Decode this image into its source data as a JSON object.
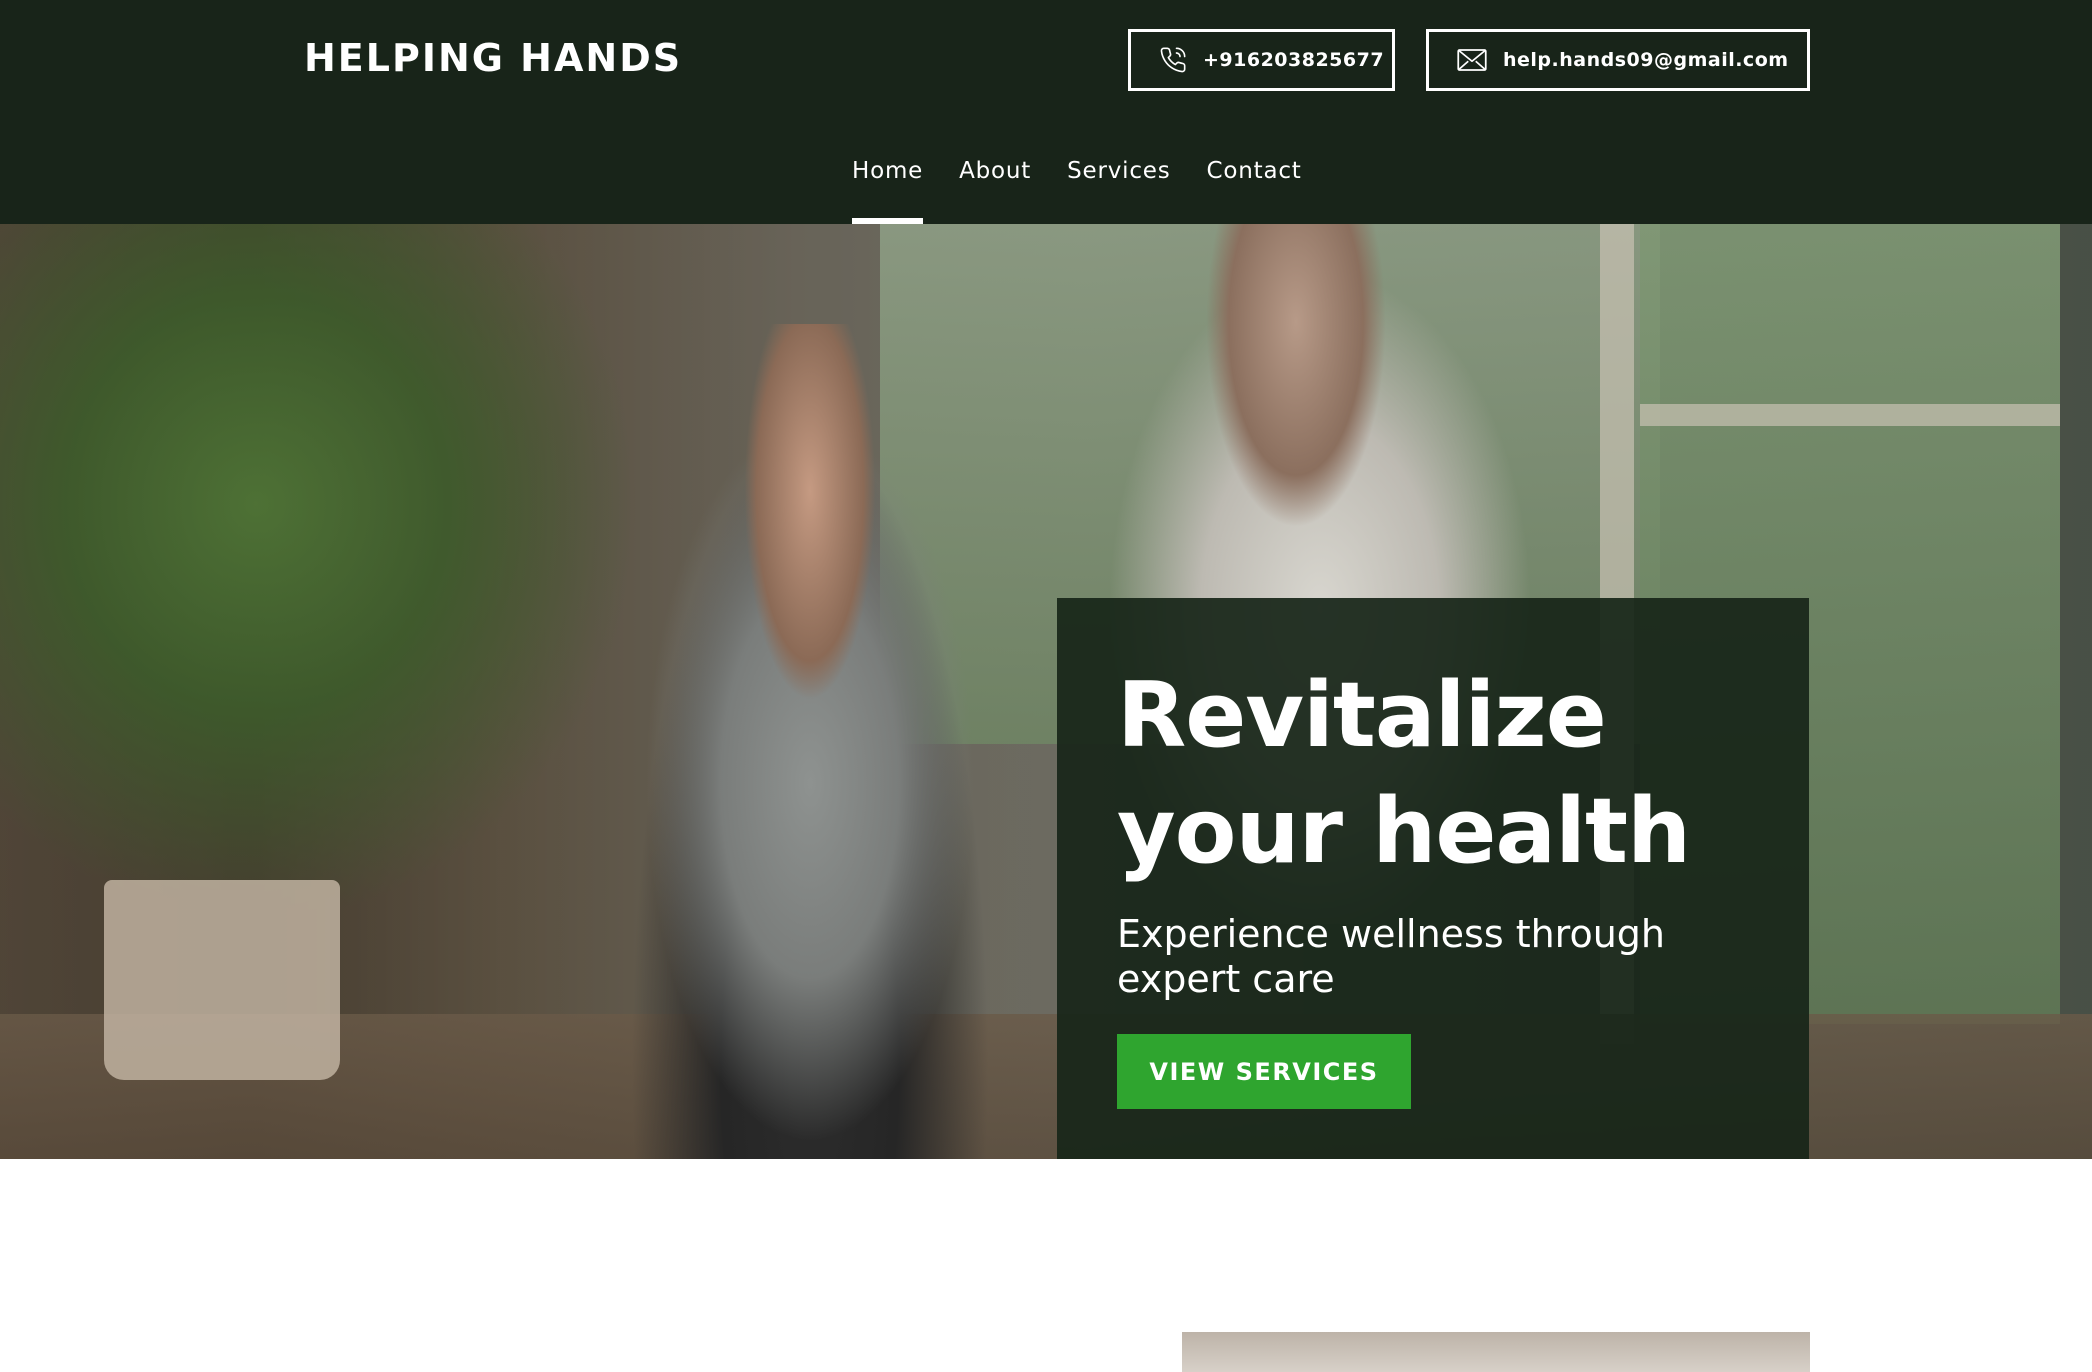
{
  "header": {
    "brand": "HELPING HANDS",
    "phone": "+916203825677",
    "email": "help.hands09@gmail.com",
    "phone_icon": "phone-icon",
    "email_icon": "mail-icon"
  },
  "nav": {
    "items": [
      {
        "label": "Home",
        "active": true
      },
      {
        "label": "About",
        "active": false
      },
      {
        "label": "Services",
        "active": false
      },
      {
        "label": "Contact",
        "active": false
      }
    ]
  },
  "hero": {
    "title_line1": "Revitalize",
    "title_line2": "your health",
    "subtitle": "Experience wellness through expert care",
    "button_label": "VIEW SERVICES"
  },
  "colors": {
    "header_bg": "#182419",
    "accent_green": "#2fa52f",
    "card_bg": "#182619"
  }
}
